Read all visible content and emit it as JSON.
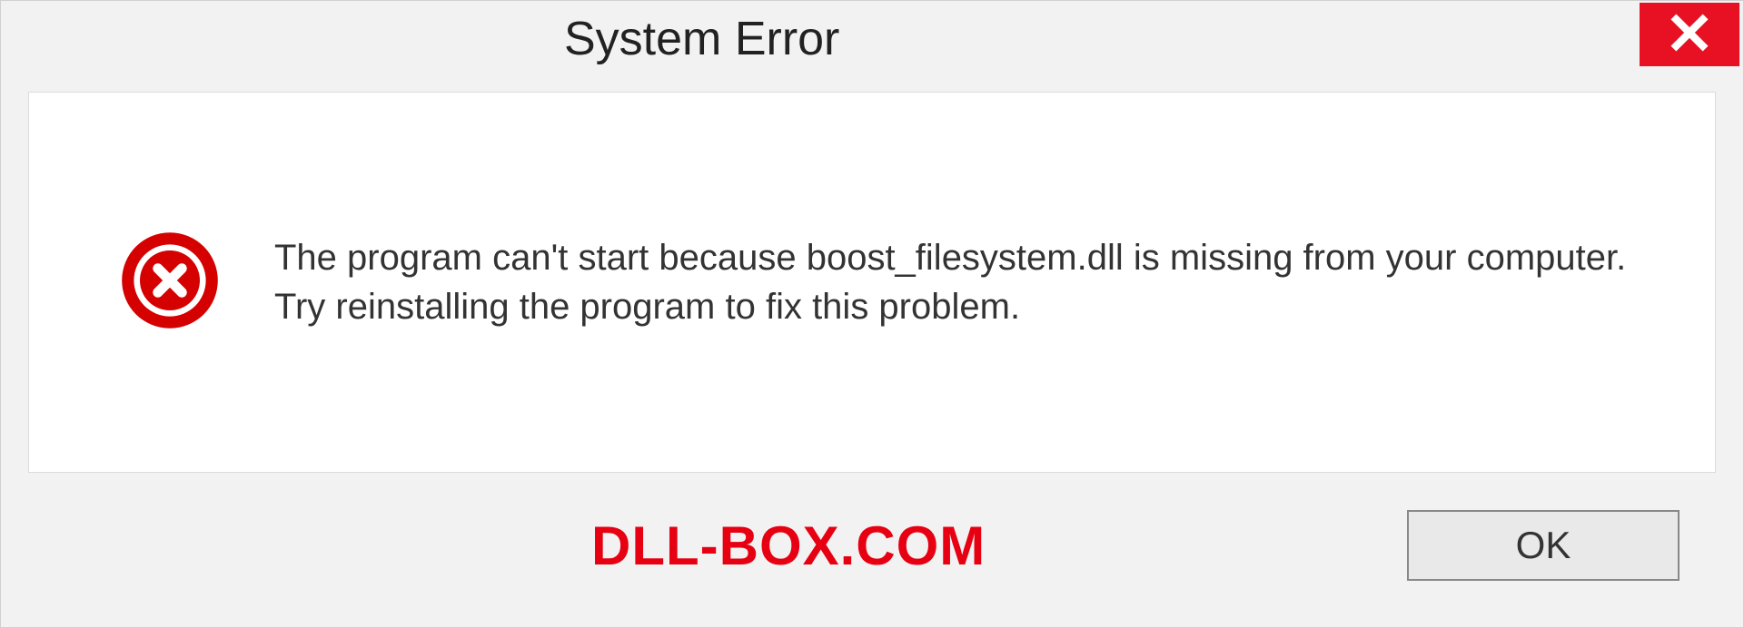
{
  "dialog": {
    "title": "System Error",
    "message": "The program can't start because boost_filesystem.dll is missing from your computer. Try reinstalling the program to fix this problem.",
    "ok_label": "OK"
  },
  "watermark": "DLL-BOX.COM",
  "colors": {
    "close_bg": "#e81123",
    "error_icon": "#d50000",
    "watermark": "#e60012"
  }
}
